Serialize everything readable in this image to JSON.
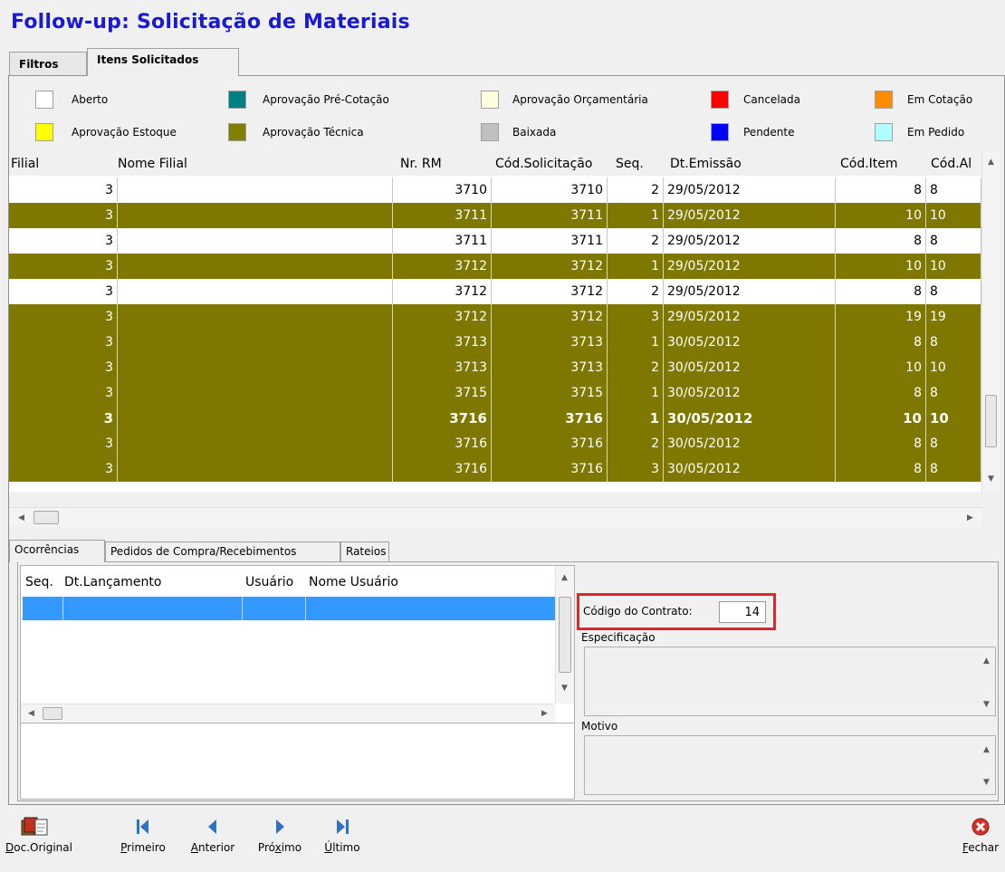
{
  "title": "Follow-up: Solicitação de Materiais",
  "top_tabs": [
    {
      "label": "Filtros",
      "active": false
    },
    {
      "label": "Itens Solicitados",
      "active": true
    }
  ],
  "legend": [
    {
      "label": "Aberto",
      "color": "#ffffff"
    },
    {
      "label": "Aprovação Pré-Cotação",
      "color": "#008080"
    },
    {
      "label": "Aprovação Orçamentária",
      "color": "#ffffe0"
    },
    {
      "label": "Cancelada",
      "color": "#ff0000"
    },
    {
      "label": "Em Cotação",
      "color": "#ff8c00"
    },
    {
      "label": "Aprovação Estoque",
      "color": "#ffff00"
    },
    {
      "label": "Aprovação Técnica",
      "color": "#808000"
    },
    {
      "label": "Baixada",
      "color": "#c0c0c0"
    },
    {
      "label": "Pendente",
      "color": "#0000ff"
    },
    {
      "label": "Em Pedido",
      "color": "#b0ffff"
    }
  ],
  "grid": {
    "headers": [
      "Filial",
      "Nome Filial",
      "Nr. RM",
      "Cód.Solicitação",
      "Seq.",
      "Dt.Emissão",
      "Cód.Item",
      "Cód.Al"
    ],
    "rows": [
      {
        "filial": "3",
        "nome": "",
        "nr_rm": "3710",
        "cod_sol": "3710",
        "seq": "2",
        "dt": "29/05/2012",
        "cod_item": "8",
        "cod_al": "8",
        "status": "Aberto"
      },
      {
        "filial": "3",
        "nome": "",
        "nr_rm": "3711",
        "cod_sol": "3711",
        "seq": "1",
        "dt": "29/05/2012",
        "cod_item": "10",
        "cod_al": "10",
        "status": "Aprovação Técnica"
      },
      {
        "filial": "3",
        "nome": "",
        "nr_rm": "3711",
        "cod_sol": "3711",
        "seq": "2",
        "dt": "29/05/2012",
        "cod_item": "8",
        "cod_al": "8",
        "status": "Aberto"
      },
      {
        "filial": "3",
        "nome": "",
        "nr_rm": "3712",
        "cod_sol": "3712",
        "seq": "1",
        "dt": "29/05/2012",
        "cod_item": "10",
        "cod_al": "10",
        "status": "Aprovação Técnica"
      },
      {
        "filial": "3",
        "nome": "",
        "nr_rm": "3712",
        "cod_sol": "3712",
        "seq": "2",
        "dt": "29/05/2012",
        "cod_item": "8",
        "cod_al": "8",
        "status": "Aberto"
      },
      {
        "filial": "3",
        "nome": "",
        "nr_rm": "3712",
        "cod_sol": "3712",
        "seq": "3",
        "dt": "29/05/2012",
        "cod_item": "19",
        "cod_al": "19",
        "status": "Aprovação Técnica"
      },
      {
        "filial": "3",
        "nome": "",
        "nr_rm": "3713",
        "cod_sol": "3713",
        "seq": "1",
        "dt": "30/05/2012",
        "cod_item": "8",
        "cod_al": "8",
        "status": "Aprovação Técnica"
      },
      {
        "filial": "3",
        "nome": "",
        "nr_rm": "3713",
        "cod_sol": "3713",
        "seq": "2",
        "dt": "30/05/2012",
        "cod_item": "10",
        "cod_al": "10",
        "status": "Aprovação Técnica"
      },
      {
        "filial": "3",
        "nome": "",
        "nr_rm": "3715",
        "cod_sol": "3715",
        "seq": "1",
        "dt": "30/05/2012",
        "cod_item": "8",
        "cod_al": "8",
        "status": "Aprovação Técnica"
      },
      {
        "filial": "3",
        "nome": "",
        "nr_rm": "3716",
        "cod_sol": "3716",
        "seq": "1",
        "dt": "30/05/2012",
        "cod_item": "10",
        "cod_al": "10",
        "status": "Aprovação Técnica",
        "selected": true
      },
      {
        "filial": "3",
        "nome": "",
        "nr_rm": "3716",
        "cod_sol": "3716",
        "seq": "2",
        "dt": "30/05/2012",
        "cod_item": "8",
        "cod_al": "8",
        "status": "Aprovação Técnica"
      },
      {
        "filial": "3",
        "nome": "",
        "nr_rm": "3716",
        "cod_sol": "3716",
        "seq": "3",
        "dt": "30/05/2012",
        "cod_item": "8",
        "cod_al": "8",
        "status": "Aprovação Técnica"
      }
    ]
  },
  "bottom_tabs": [
    {
      "label": "Ocorrências",
      "active": true
    },
    {
      "label": "Pedidos de Compra/Recebimentos",
      "active": false
    },
    {
      "label": "Rateios",
      "active": false
    }
  ],
  "occurrences": {
    "headers": [
      "Seq.",
      "Dt.Lançamento",
      "Usuário",
      "Nome Usuário"
    ]
  },
  "contract": {
    "label": "Código do Contrato:",
    "value": "14"
  },
  "specification_label": "Especificação",
  "reason_label": "Motivo",
  "toolbar": {
    "doc_original": {
      "pre": "",
      "u": "D",
      "post": "oc.Original"
    },
    "primeiro": {
      "pre": "",
      "u": "P",
      "post": "rimeiro"
    },
    "anterior": {
      "pre": "",
      "u": "A",
      "post": "nterior"
    },
    "proximo": {
      "pre": "Pró",
      "u": "x",
      "post": "imo"
    },
    "ultimo": {
      "pre": "",
      "u": "Ú",
      "post": "ltimo"
    },
    "fechar": {
      "pre": "",
      "u": "F",
      "post": "echar"
    }
  },
  "colors": {
    "olive": "#7f7800",
    "title": "#1a1ad6",
    "selection": "#3399ff",
    "highlight": "#d9282e",
    "nav": "#2f72c4",
    "close": "#d9302a"
  }
}
